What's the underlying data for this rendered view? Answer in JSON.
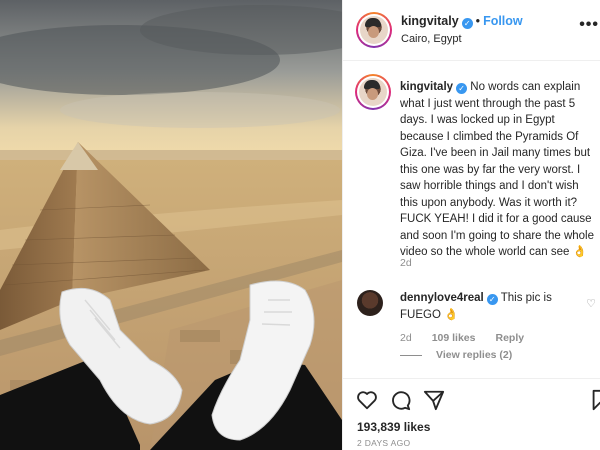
{
  "post": {
    "username": "kingvitaly",
    "follow_label": "Follow",
    "separator": "•",
    "location": "Cairo, Egypt",
    "more_label": "•••"
  },
  "caption": {
    "username": "kingvitaly",
    "text": "No words can explain what I just went through the past 5 days. I was locked up in Egypt because I climbed the Pyramids Of Giza. I've been in Jail many times but this one was by far the very worst. I saw horrible things and I don't wish this upon anybody. Was it worth it? FUCK YEAH! I did it for a good cause and soon I'm going to share the whole video so the whole world can see 👌",
    "time": "2d"
  },
  "comment": {
    "username": "dennylove4real",
    "text": "This pic is FUEGO 👌",
    "time": "2d",
    "likes": "109 likes",
    "reply": "Reply",
    "view_replies": "View replies (2)"
  },
  "stats": {
    "likes": "193,839 likes",
    "date": "2 DAYS AGO"
  },
  "colors": {
    "accent": "#3897f0",
    "muted": "#8e8e8e",
    "text": "#262626"
  },
  "icons": [
    "heart-icon",
    "comment-icon",
    "share-icon",
    "bookmark-icon",
    "verified-icon",
    "more-icon"
  ]
}
